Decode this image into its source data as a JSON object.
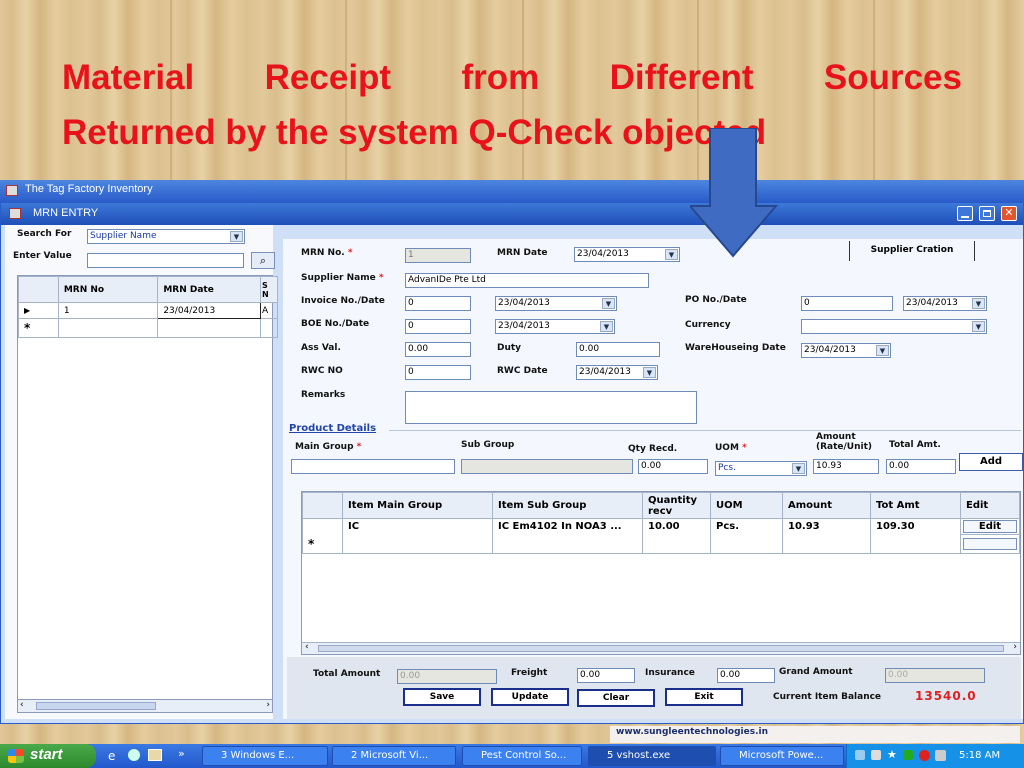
{
  "slide": {
    "title_line1": "Material Receipt from Different Sources",
    "title_line2": "Returned by the system Q-Check objected"
  },
  "app": {
    "title": "The Tag Factory Inventory"
  },
  "mrn_window": {
    "title": "MRN ENTRY",
    "supplier_tab": "Supplier Cration"
  },
  "search": {
    "search_for_label": "Search For",
    "search_for_value": "Supplier Name",
    "enter_value_label": "Enter Value",
    "enter_value": ""
  },
  "left_grid": {
    "columns": [
      "MRN No",
      "MRN Date",
      "S N"
    ],
    "rows": [
      {
        "mrn_no": "1",
        "mrn_date": "23/04/2013",
        "s": "A"
      }
    ]
  },
  "form": {
    "mrn_no_label": "MRN No.",
    "mrn_no": "1",
    "mrn_date_label": "MRN Date",
    "mrn_date": "23/04/2013",
    "supplier_label": "Supplier Name",
    "supplier": "AdvanIDe Pte Ltd",
    "invoice_label": "Invoice No./Date",
    "invoice_no": "0",
    "invoice_date": "23/04/2013",
    "po_label": "PO No./Date",
    "po_no": "0",
    "po_date": "23/04/2013",
    "boe_label": "BOE No./Date",
    "boe_no": "0",
    "boe_date": "23/04/2013",
    "currency_label": "Currency",
    "currency": "",
    "ass_label": "Ass Val.",
    "ass_val": "0.00",
    "duty_label": "Duty",
    "duty": "0.00",
    "warehousing_label": "WareHouseing Date",
    "warehousing_date": "23/04/2013",
    "rwc_no_label": "RWC NO",
    "rwc_no": "0",
    "rwc_date_label": "RWC Date",
    "rwc_date": "23/04/2013",
    "remarks_label": "Remarks",
    "remarks": ""
  },
  "product": {
    "section_label": "Product Details",
    "main_group_label": "Main Group",
    "main_group": "",
    "sub_group_label": "Sub Group",
    "sub_group": "",
    "qty_label": "Qty Recd.",
    "qty": "0.00",
    "uom_label": "UOM",
    "uom": "Pcs.",
    "amount_label_1": "Amount",
    "amount_label_2": "(Rate/Unit)",
    "amount": "10.93",
    "total_label": "Total Amt.",
    "total": "0.00",
    "add_label": "Add"
  },
  "item_grid": {
    "columns": [
      "Item Main Group",
      "Item Sub Group",
      "Quantity recv",
      "UOM",
      "Amount",
      "Tot Amt",
      "Edit"
    ],
    "rows": [
      {
        "main": "IC",
        "sub": "IC Em4102 In NOA3 ...",
        "qty": "10.00",
        "uom": "Pcs.",
        "amount": "10.93",
        "tot": "109.30",
        "edit": "Edit"
      }
    ]
  },
  "totals": {
    "total_amount_label": "Total Amount",
    "total_amount": "0.00",
    "freight_label": "Freight",
    "freight": "0.00",
    "insurance_label": "Insurance",
    "insurance": "0.00",
    "grand_label": "Grand Amount",
    "grand": "0.00",
    "balance_label": "Current Item Balance",
    "balance": "13540.0"
  },
  "buttons": {
    "save": "Save",
    "update": "Update",
    "clear": "Clear",
    "exit": "Exit"
  },
  "footer_url": "www.sungleentechnologies.in",
  "taskbar": {
    "start": "start",
    "tasks": [
      "3 Windows E...",
      "2 Microsoft Vi...",
      "Pest Control So...",
      "5 vshost.exe",
      "Microsoft Powe..."
    ],
    "clock": "5:18 AM"
  },
  "colors": {
    "title_red": "#e8121a",
    "xp_blue": "#2a5cc9",
    "balance_red": "#e02020"
  }
}
